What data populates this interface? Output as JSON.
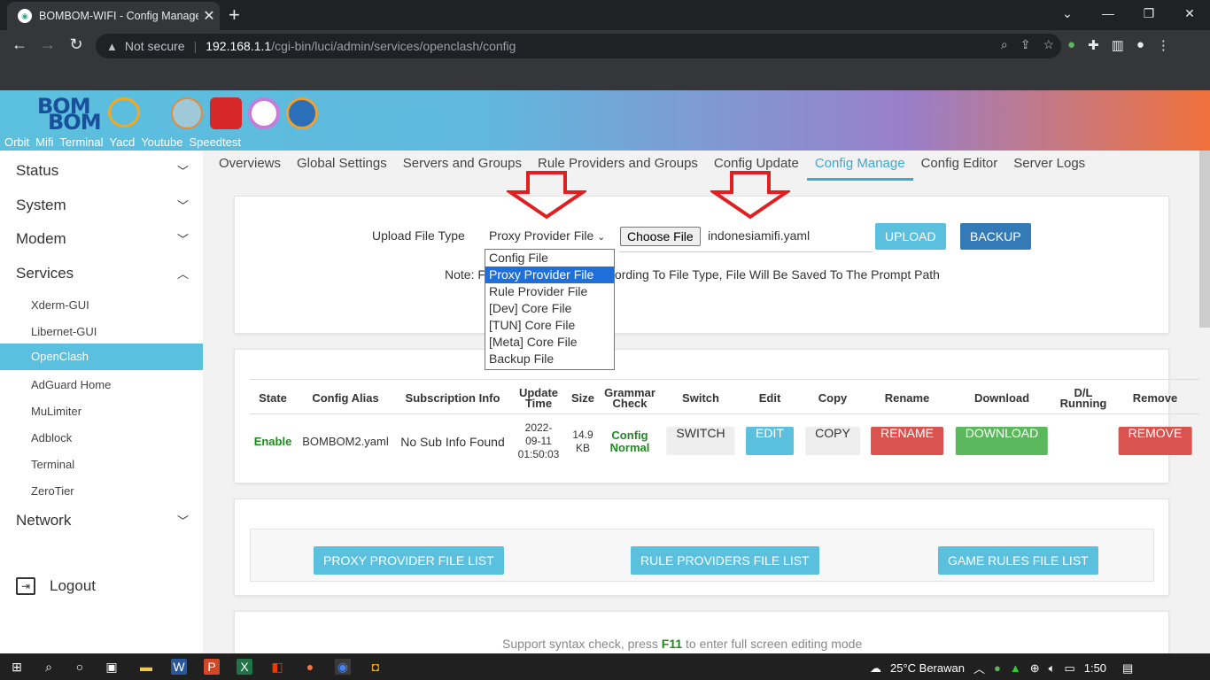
{
  "browser": {
    "tab_title": "BOMBOM-WIFI - Config Manage",
    "tab_close": "✕",
    "new_tab": "+",
    "not_secure": "Not secure",
    "url_host": "192.168.1.1",
    "url_path": "/cgi-bin/luci/admin/services/openclash/config"
  },
  "header": {
    "logo_line1": "BOM",
    "logo_line2": "BOM",
    "links": [
      "Orbit",
      "Mifi",
      "Terminal",
      "Yacd",
      "Youtube",
      "Speedtest"
    ]
  },
  "sidebar": {
    "main_items": [
      "Status",
      "System",
      "Modem",
      "Services",
      "Network"
    ],
    "sub_items": [
      "Xderm-GUI",
      "Libernet-GUI",
      "OpenClash",
      "AdGuard Home",
      "MuLimiter",
      "Adblock",
      "Terminal",
      "ZeroTier"
    ],
    "active_sub": "OpenClash",
    "logout": "Logout"
  },
  "tabs": [
    "Overviews",
    "Global Settings",
    "Servers and Groups",
    "Rule Providers and Groups",
    "Config Update",
    "Config Manage",
    "Config Editor",
    "Server Logs"
  ],
  "upload": {
    "label": "Upload File Type",
    "selected": "Proxy Provider File",
    "choose_file": "Choose File",
    "file_name": "indonesiamifi.yaml",
    "upload_btn": "UPLOAD",
    "backup_btn": "BACKUP",
    "note_prefix": "Note: F",
    "note_suffix": "ording To File Type, File Will Be Saved To The Prompt Path",
    "options": [
      "Config File",
      "Proxy Provider File",
      "Rule Provider File",
      "[Dev] Core File",
      "[TUN] Core File",
      "[Meta] Core File",
      "Backup File"
    ]
  },
  "table": {
    "headers": {
      "state": "State",
      "alias": "Config Alias",
      "sub": "Subscription Info",
      "update1": "Update",
      "update2": "Time",
      "size": "Size",
      "grammar1": "Grammar",
      "grammar2": "Check",
      "switch": "Switch",
      "edit": "Edit",
      "copy": "Copy",
      "rename": "Rename",
      "download": "Download",
      "dl1": "D/L",
      "dl2": "Running",
      "remove": "Remove"
    },
    "row": {
      "state": "Enable",
      "alias": "BOMBOM2.yaml",
      "sub": "No Sub Info Found",
      "time1": "2022-",
      "time2": "09-11",
      "time3": "01:50:03",
      "size1": "14.9",
      "size2": "KB",
      "grammar1": "Config",
      "grammar2": "Normal",
      "switch": "SWITCH",
      "edit": "EDIT",
      "copy": "COPY",
      "rename": "RENAME",
      "download": "DOWNLOAD",
      "remove": "REMOVE"
    }
  },
  "file_lists": {
    "proxy": "PROXY PROVIDER FILE LIST",
    "rule": "RULE PROVIDERS FILE LIST",
    "game": "GAME RULES FILE LIST"
  },
  "syntax_note": {
    "prefix": "Support syntax check, press ",
    "key": "F11",
    "suffix": " to enter full screen editing mode"
  },
  "taskbar": {
    "weather": "25°C  Berawan",
    "time": "1:50"
  },
  "colors": {
    "info": "#5bc0de",
    "primary": "#337ab7",
    "danger": "#d9534f",
    "success": "#5cb85c",
    "green_text": "#1f8a1f",
    "arrow_red": "#e02020"
  }
}
